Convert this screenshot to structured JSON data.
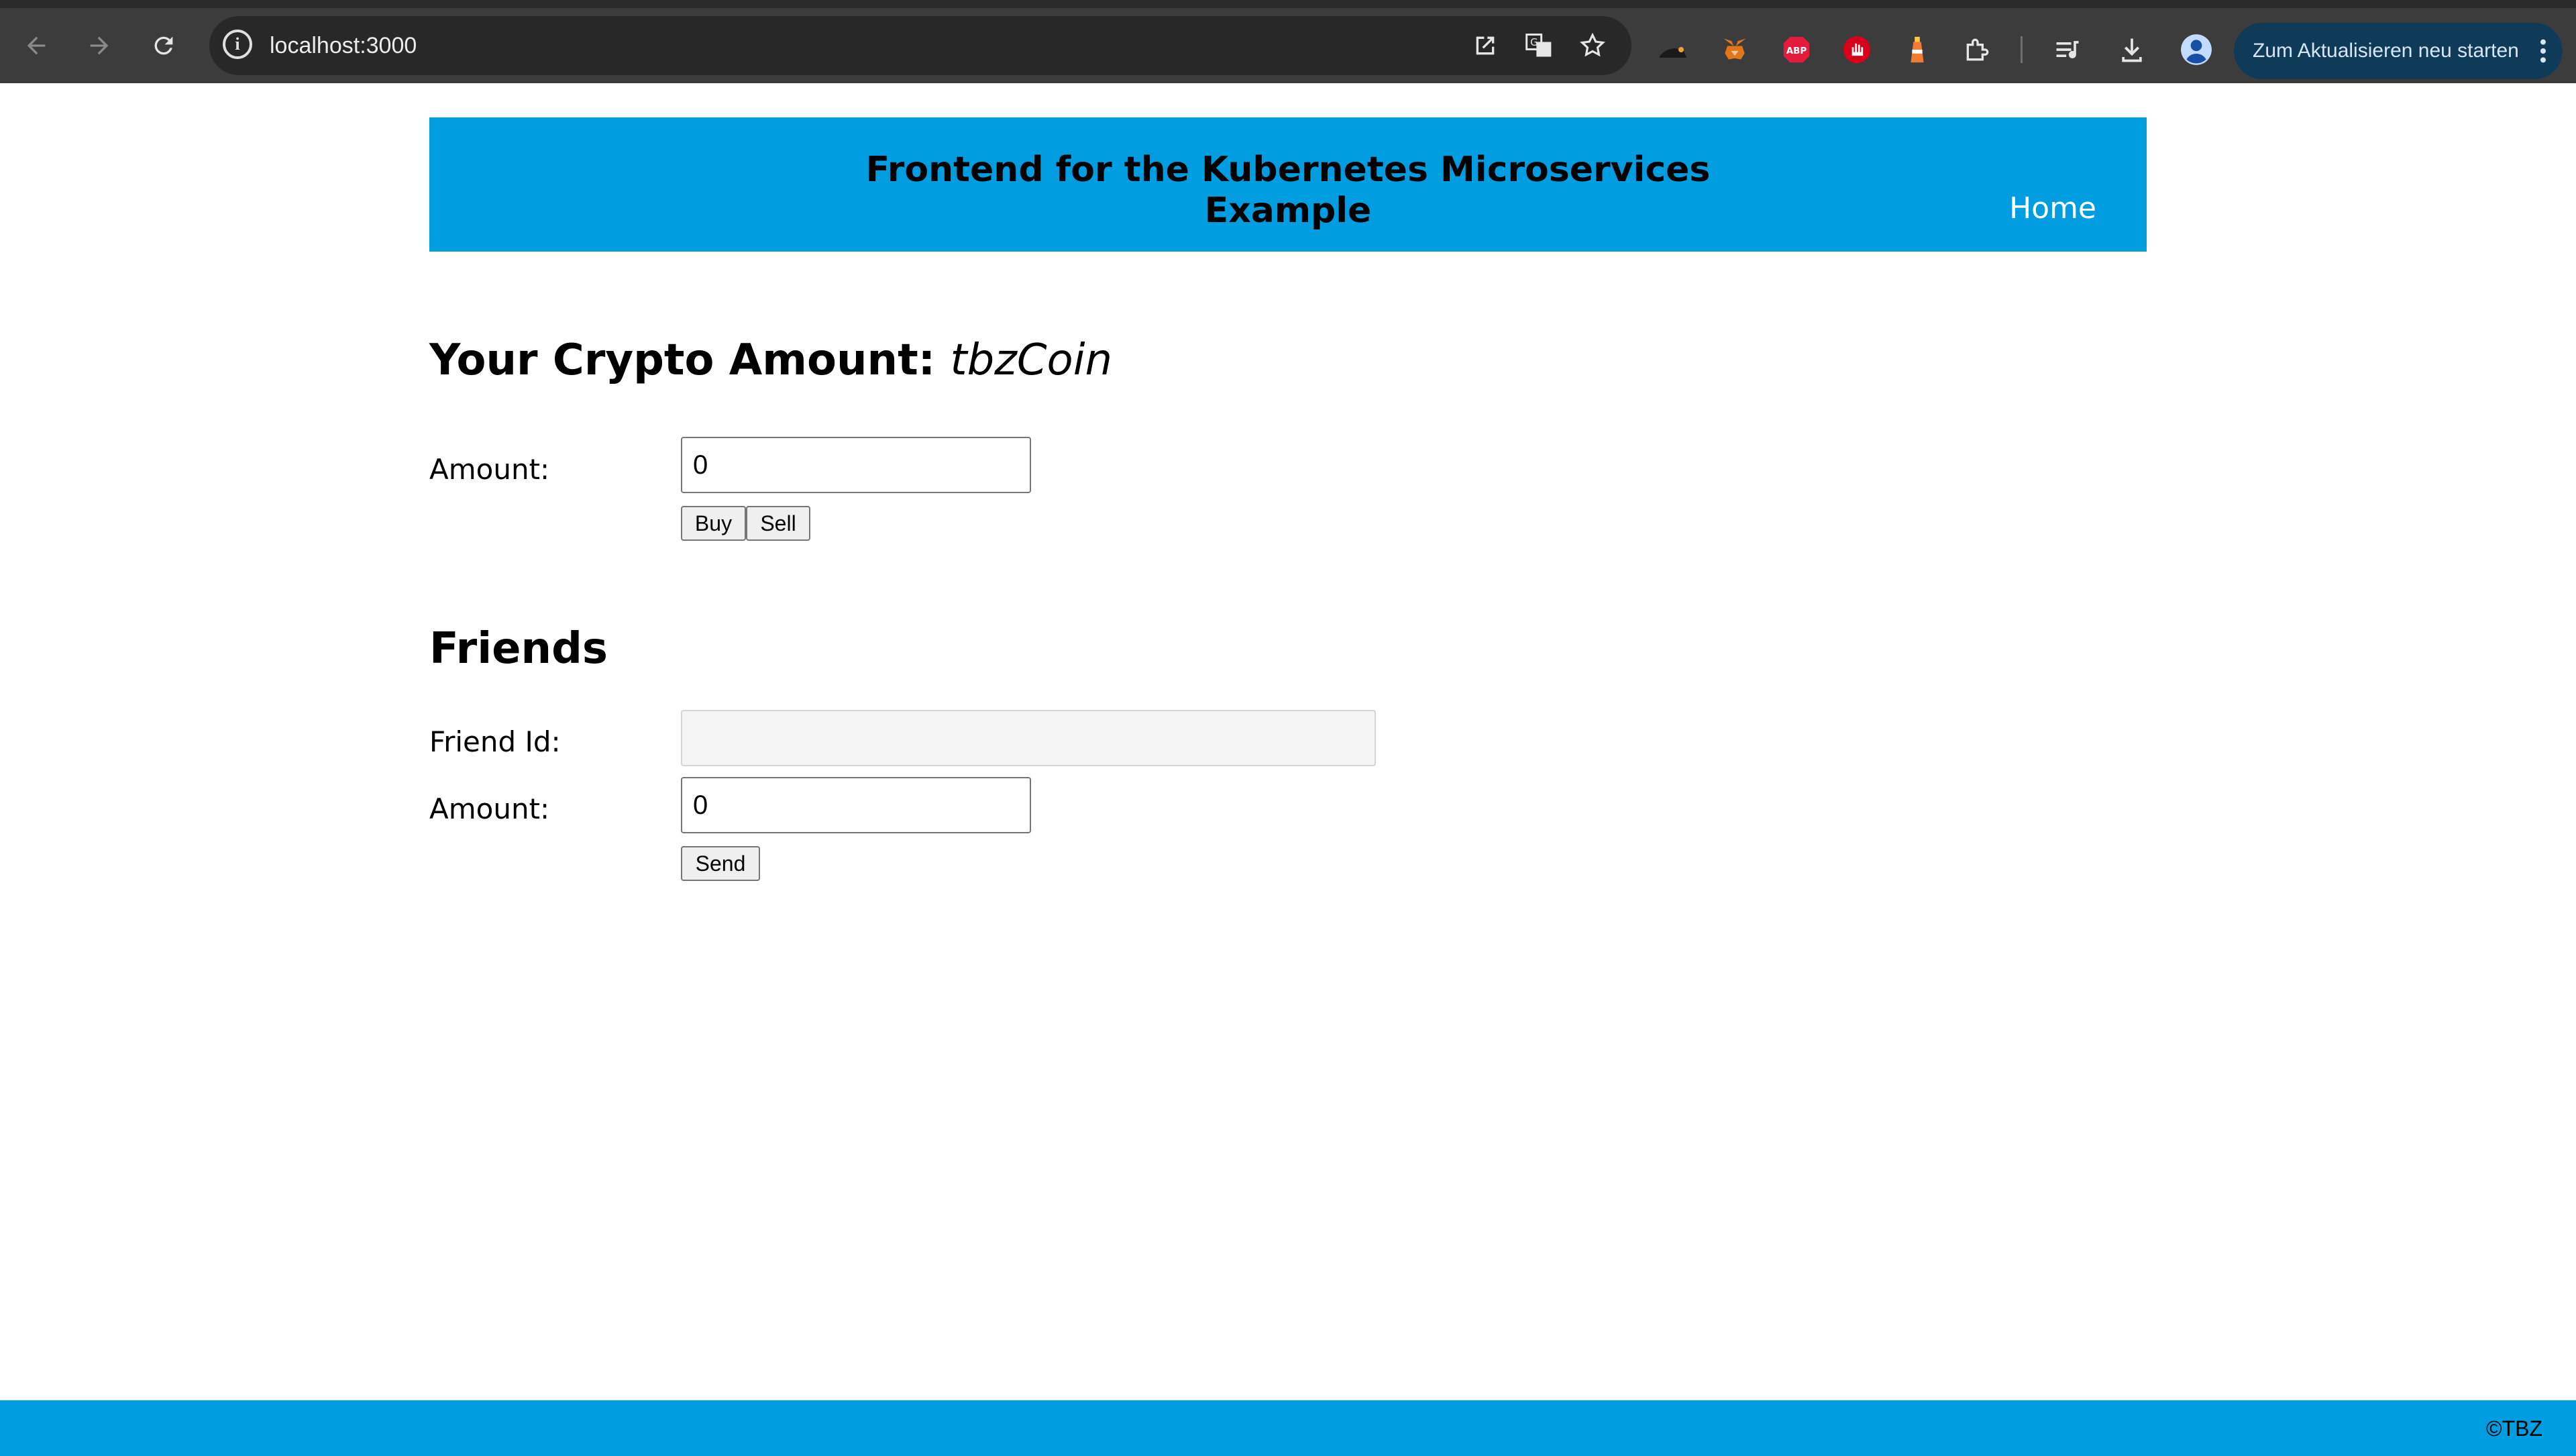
{
  "browser": {
    "url": "localhost:3000",
    "update_button": "Zum Aktualisieren neu starten",
    "icons": [
      "back-icon",
      "forward-icon",
      "reload-icon",
      "site-info-icon",
      "open-external-icon",
      "translate-icon",
      "bookmark-star-icon",
      "extension-bat-icon",
      "metamask-fox-icon",
      "adblock-plus-icon",
      "ublock-hand-icon",
      "extension-lighthouse-icon",
      "extensions-puzzle-icon",
      "media-queue-icon",
      "download-icon",
      "profile-avatar-icon",
      "more-menu-icon"
    ],
    "abp_label": "ABP"
  },
  "header": {
    "title_line1": "Frontend for the Kubernetes Microservices",
    "title_line2": "Example",
    "nav_home": "Home"
  },
  "crypto": {
    "heading": "Your Crypto Amount:",
    "coin_name": "tbzCoin",
    "amount_label": "Amount:",
    "amount_value": "0",
    "buy_label": "Buy",
    "sell_label": "Sell"
  },
  "friends": {
    "heading": "Friends",
    "friend_id_label": "Friend Id:",
    "friend_id_value": "",
    "amount_label": "Amount:",
    "amount_value": "0",
    "send_label": "Send"
  },
  "footer": {
    "copyright": "©TBZ"
  },
  "colors": {
    "brand": "#009de0",
    "chrome": "#3c3c3c",
    "omnibox": "#282828",
    "update_button": "#0f3b59"
  }
}
